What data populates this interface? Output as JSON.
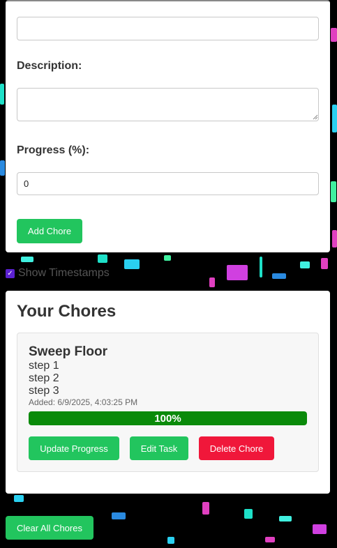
{
  "form": {
    "title_value": "",
    "description_label": "Description:",
    "description_value": "",
    "progress_label": "Progress (%):",
    "progress_value": "0",
    "add_button": "Add Chore"
  },
  "show_timestamps": {
    "label": "Show Timestamps",
    "checked": true
  },
  "list": {
    "title": "Your Chores",
    "chores": [
      {
        "name": "Sweep Floor",
        "steps": [
          "step 1",
          "step 2",
          "step 3"
        ],
        "added": "Added: 6/9/2025, 4:03:25 PM",
        "progress": 100,
        "progress_text": "100%",
        "update_button": "Update Progress",
        "edit_button": "Edit Task",
        "delete_button": "Delete Chore"
      }
    ]
  },
  "clear_button": "Clear All Chores",
  "colors": {
    "accent_green": "#22c55e",
    "danger_red": "#f0173a",
    "progress_green": "#0a8a0a",
    "checkbox": "#5b21d1",
    "background": "#000000"
  }
}
